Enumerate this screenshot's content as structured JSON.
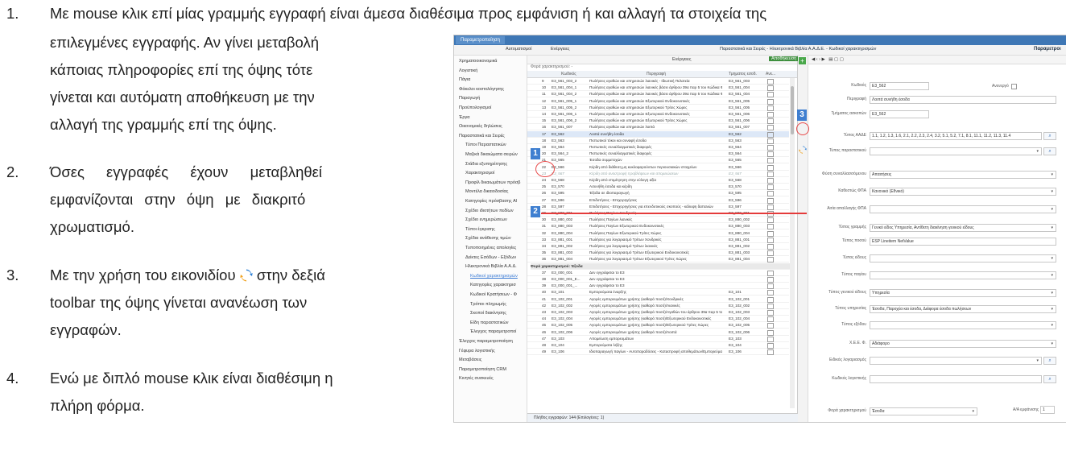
{
  "doc": {
    "items": [
      {
        "num": "1.",
        "lines": [
          "Με mouse κλικ επί μίας γραμμής εγγραφή είναι άμεσα διαθέσιμα προς εμφάνιση ή και αλλαγή τα στοιχεία της",
          "επιλεγμένες εγγραφής. Αν γίνει μεταβολή",
          "κάποιας πληροφορίες επί της όψης τότε",
          "γίνεται και αυτόματη αποθήκευση με την",
          "αλλαγή της γραμμής επί της όψης."
        ]
      },
      {
        "num": "2.",
        "lines": [
          "Όσες εγγραφές έχουν μεταβληθεί",
          "εμφανίζονται στην όψη με διακριτό",
          "χρωματισμό."
        ]
      },
      {
        "num": "3.",
        "lines": [
          "Με την χρήση του εικονιδίου",
          "στην δεξιά",
          "toolbar της όψης γίνεται ανανέωση των",
          "εγγραφών."
        ]
      },
      {
        "num": "4.",
        "lines": [
          "Ενώ με διπλό mouse κλικ είναι διαθέσιμη η",
          "πλήρη φόρμα."
        ]
      }
    ]
  },
  "shot": {
    "tab": "Παραμετροποίηση",
    "toolbar_items": [
      "Αυτοματισμοί",
      "Ενέργειες",
      "Ενέργειες",
      "Αποθήκευση"
    ],
    "right_title": "Παραστατικά και Σειρές - Ηλεκτρονικά Βιβλία Α.Α.Δ.Ε. - Κωδικοί χαρακτηρισμών",
    "right_title2": "Παραμετροι",
    "nav": [
      "Χρηματοοικονομικά",
      "Λογιστική",
      "Πάγια",
      "Φάκελοι κοστολόγησης",
      "Παραγωγή",
      "Προϋπολογισμοί",
      "Έργα",
      "Οικονομικές δηλώσεις",
      "Παραστατικά και Σειρές",
      "Τύποι Παραστατικών",
      "Μαζικά δικαιώματα σειρών",
      "Στάδια εξυπηρέτησης",
      "Χαρακτηρισμοί",
      "Προφίλ δικαιωμάτων πρόσβ",
      "Μοντέλα δικαιοδοσίας",
      "Κατηγορίες πρόσβασης Al",
      "Σχέδιο ιδιοτήτων πεδίων",
      "Σχέδιο ενημερώσεων",
      "Τύποι έγκρισης",
      "Σχέδια ανάθεσης τιμών",
      "Τυποποιημένες απολογίες",
      "Δείκτες Εσόδων - Εξόδων",
      "Ηλεκτρονικά Βιβλία Α.Α.Δ.",
      "Κωδικοί χαρακτηρισμών",
      "Κατηγορίες χαρακτηρισ",
      "Κωδικοί Κρατήσεων - Φ",
      "Τρόποι πληρωμής",
      "Σκοποί διακίνησης",
      "Είδη παραστατικών",
      "Έλεγχος παραμετροποί",
      "Έλεγχος παραμετροποίηση",
      "Γέφυρα λογιστικής",
      "Μεταβάσεις",
      "Παραμετροποίηση CRM",
      "Κινητές συσκευές"
    ],
    "grid": {
      "group_label": "Φορά χαρακτηρισμού: -",
      "headers": [
        "Κωδικός",
        "Περιγραφή",
        "Τμηματος εσοδ.",
        "Ανε..."
      ],
      "group2_label": "Φορά χαρακτηρισμού: Έξοδα",
      "rows": [
        [
          "9",
          "E3_561_003_2",
          "Πωλήσεις αγαθών και υπηρεσιών λιανικές - Ιδιωτική Πελατεία",
          "E3_561_003"
        ],
        [
          "10",
          "E3_561_004_1",
          "Πωλήσεις αγαθών και υπηρεσιών λιανικές βάσει άρθρου 39α παρ 5 του Κώδικα Φ.Π.Α (...",
          "E3_561_004"
        ],
        [
          "11",
          "E3_561_004_2",
          "Πωλήσεις αγαθών και υπηρεσιών λιανικές βάσει άρθρου 39α παρ 5 του Κώδικα Φ.Π.Α (...",
          "E3_561_004"
        ],
        [
          "12",
          "E3_561_005_1",
          "Πωλήσεις αγαθών και υπηρεσιών Εξωτερικού Ενδοκοινοτικές",
          "E3_561_005"
        ],
        [
          "13",
          "E3_561_005_2",
          "Πωλήσεις αγαθών και υπηρεσιών Εξωτερικού Τρίτες Χώρες",
          "E3_561_005"
        ],
        [
          "14",
          "E3_561_006_1",
          "Πωλήσεις αγαθών και υπηρεσιών Εξωτερικού Ενδοκοινοτικές",
          "E3_561_006"
        ],
        [
          "15",
          "E3_561_006_2",
          "Πωλήσεις αγαθών και υπηρεσιών Εξωτερικού Τρίτες Χώρες",
          "E3_561_006"
        ],
        [
          "16",
          "E3_561_007",
          "Πωλήσεις αγαθών και υπηρεσιών λοιπά",
          "E3_561_007"
        ],
        [
          "17",
          "E3_562",
          "Λοιπά συνήθη έσοδα",
          "E3_562"
        ],
        [
          "18",
          "E3_563",
          "Πιστωτικοί τόκοι και συναφή έσοδα",
          "E3_563"
        ],
        [
          "19",
          "E3_564",
          "Πιστωτικές συναλλαγματικές διαφορές",
          "E3_564"
        ],
        [
          "20",
          "E3_564_2",
          "Πιστωτικές συναλλαγματικές διαφορές",
          "E3_564"
        ],
        [
          "21",
          "E3_565",
          "Έσοδα συμμετοχών",
          "E3_565"
        ],
        [
          "22",
          "E3_566",
          "Κέρδη από διάθεση μη κυκλοφορούντων περιουσιακών στοιχείων",
          "E3_566"
        ],
        [
          "23",
          "E3_567",
          "Κέρδη από αναστροφή προβλέψεων και απομειώσεων",
          "E3_567"
        ],
        [
          "24",
          "E3_568",
          "Κέρδη από επιμέτρηση στην εύλογη αξία",
          "E3_568"
        ],
        [
          "25",
          "E3_570",
          "Ασυνήθη έσοδα και κέρδη",
          "E3_570"
        ],
        [
          "26",
          "E3_595",
          "Έξοδα σε ιδιοπαραγωγή",
          "E3_595"
        ],
        [
          "27",
          "E3_596",
          "Επιδοτήσεις - Επιχορηγήσεις",
          "E3_596"
        ],
        [
          "28",
          "E3_597",
          "Επιδοτήσεις - Επιχορηγήσεις για επενδυτικούς σκοπούς - κάλυψη δαπανών",
          "E3_597"
        ],
        [
          "29",
          "E3_880_001",
          "Πωλήσεις Παγίων Χονδρικές",
          "E3_880_001"
        ],
        [
          "30",
          "E3_880_002",
          "Πωλήσεις Παγίων λιανικές",
          "E3_880_002"
        ],
        [
          "31",
          "E3_880_003",
          "Πωλήσεις Παγίων Εξωτερικού Ενδοκοινοτικές",
          "E3_880_003"
        ],
        [
          "32",
          "E3_880_004",
          "Πωλήσεις Παγίων Εξωτερικού Τρίτες Χώρες",
          "E3_880_004"
        ],
        [
          "33",
          "E3_881_001",
          "Πωλήσεις για λογαριασμό Τρίτων Χονδρικές",
          "E3_881_001"
        ],
        [
          "34",
          "E3_881_002",
          "Πωλήσεις για λογαριασμό Τρίτων λιανικές",
          "E3_881_002"
        ],
        [
          "35",
          "E3_881_003",
          "Πωλήσεις για λογαριασμό Τρίτων Εξωτερικού Ενδοκοινοτικές",
          "E3_881_003"
        ],
        [
          "36",
          "E3_881_004",
          "Πωλήσεις για λογαριασμό Τρίτων Εξωτερικού Τρίτες Χώρες",
          "E3_881_004"
        ]
      ],
      "rows2": [
        [
          "37",
          "E3_000_001",
          "Δεν εγγράφεται το Ε3",
          ""
        ],
        [
          "38",
          "E3_000_001_E...",
          "Δεν εγγράφεται το Ε3",
          ""
        ],
        [
          "39",
          "E3_000_001_...",
          "Δεν εγγράφεται το Ε3",
          ""
        ],
        [
          "40",
          "E3_101",
          "Εμπορεύματα έναρξης",
          "E3_101"
        ],
        [
          "41",
          "E3_102_001",
          "Αγορές εμπορευμάτων χρήσης (καθαρό ποσό)/Χονδρικές",
          "E3_102_001"
        ],
        [
          "42",
          "E3_102_002",
          "Αγορές εμπορευμάτων χρήσης (καθαρό ποσό)/Λιανικές",
          "E3_102_002"
        ],
        [
          "43",
          "E3_102_003",
          "Αγορές εμπορευμάτων χρήσης (καθαρό ποσό)/Αγαθών του άρθρου 39α παρ 5 του Κώδικ...",
          "E3_102_003"
        ],
        [
          "44",
          "E3_102_004",
          "Αγορές εμπορευμάτων χρήσης (καθαρό ποσό)/Εξωτερικού Ενδοκοινοτικές",
          "E3_102_004"
        ],
        [
          "45",
          "E3_102_005",
          "Αγορές εμπορευμάτων χρήσης (καθαρό ποσό)/Εξωτερικού Τρίτες Χώρες",
          "E3_102_005"
        ],
        [
          "46",
          "E3_102_006",
          "Αγορές εμπορευμάτων χρήσης (καθαρό ποσό)/Λοιπά",
          "E3_102_006"
        ],
        [
          "47",
          "E3_103",
          "Απομείωση εμπορευμάτων",
          "E3_103"
        ],
        [
          "48",
          "E3_104",
          "Εμπορεύματα λήξης",
          "E3_104"
        ],
        [
          "49",
          "E3_106",
          "Ιδιοπαραγωγή παγίων - Αυτοπαραδόσεις - Καταστροφή αποθεμάτων/Εμπορεύματα",
          "E3_106"
        ]
      ],
      "footer": "Πλήθος εγγραφών: 144 (Επιλογένες: 1)"
    },
    "form": {
      "fields": [
        {
          "label": "Κωδικός",
          "value": "E3_562"
        },
        {
          "label": "Περιγραφή",
          "value": "Λοιπά συνήθη έσοδα"
        },
        {
          "label": "Τμήματος ασκοπών",
          "value": "E3_562"
        },
        {
          "label": "Τύπος ΑΑΔΕ",
          "value": "1.1, 1.2, 1.3, 1.6, 2.1, 2.2, 2.3, 2.4, 3.2, 5.1, 5.2, 7.1, 8.1, 11.1, 11.2, 11.3, 11.4"
        },
        {
          "label": "Τύπος παραστατικού",
          "value": ""
        },
        {
          "label": "Φύση συναλλασσόμενου",
          "value": "Απαιτήσεις"
        },
        {
          "label": "Καθεστώς ΦΠΑ",
          "value": "Κανονικό (Εθνικό)"
        },
        {
          "label": "Αιτία απαλλαγής ΦΠΑ",
          "value": ""
        },
        {
          "label": "Τύπος γραμμής",
          "value": "Γενικό είδος Υπηρεσία, Αντίθετη διακίνηση γενικού είδους"
        },
        {
          "label": "Τύπος ποσού",
          "value": "ESP Lineitem NetValue"
        },
        {
          "label": "Τύπος είδους",
          "value": ""
        },
        {
          "label": "Τύπος παγίου",
          "value": ""
        },
        {
          "label": "Τύπος γενικού είδους",
          "value": "Υπηρεσία"
        },
        {
          "label": "Τύπος υπηρεσίας",
          "value": "Έσοδα, Παροχέα και έσοδα, Διάφορα έσοδα πωλήσεων"
        },
        {
          "label": "Τύπος εξόδου",
          "value": ""
        },
        {
          "label": "Χ.Ε.Ε. Φ.",
          "value": "Αδιάφορο"
        },
        {
          "label": "Ειδικός λογαριασμός",
          "value": ""
        },
        {
          "label": "Κωδικός λογιστικής",
          "value": ""
        },
        {
          "label": "Φορά χαρακτηρισμού",
          "value": "Έσοδα"
        }
      ],
      "inactive_label": "Ανενεργό",
      "order_label": "Α/Α εμφάνισης",
      "order_value": "1"
    },
    "badges": [
      "1",
      "2",
      "3"
    ]
  }
}
